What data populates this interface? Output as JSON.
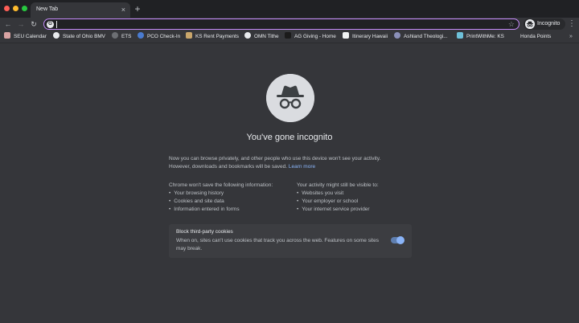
{
  "tab": {
    "title": "New Tab",
    "close_glyph": "×",
    "new_tab_glyph": "+"
  },
  "toolbar": {
    "back_glyph": "←",
    "forward_glyph": "→",
    "reload_glyph": "↻",
    "address_value": "",
    "search_engine_glyph": "G",
    "star_glyph": "☆",
    "profile_label": "Incognito",
    "menu_glyph": "⋮"
  },
  "bookmarks": [
    {
      "label": "SEU Calendar",
      "icon": "calendar-favicon",
      "color": "#d9a3a3"
    },
    {
      "label": "State of Ohio BMV",
      "icon": "globe-favicon",
      "color": "#e8eaed"
    },
    {
      "label": "ETS",
      "icon": "ets-favicon",
      "color": "#6c6f73"
    },
    {
      "label": "PCO Check-In",
      "icon": "pco-favicon",
      "color": "#4a7bd0"
    },
    {
      "label": "KS Rent Payments",
      "icon": "ks-favicon",
      "color": "#c9a66b"
    },
    {
      "label": "OMN Tithe",
      "icon": "globe-favicon",
      "color": "#e8eaed"
    },
    {
      "label": "AG Giving - Home",
      "icon": "ag-favicon",
      "color": "#1b1b1b"
    },
    {
      "label": "Itinerary Hawaii",
      "icon": "doc-favicon",
      "color": "#f1f3f4"
    },
    {
      "label": "Ashland Theologi...",
      "icon": "ashland-favicon",
      "color": "#8a8fb8"
    },
    {
      "label": "PrintWithMe: KS",
      "icon": "printwithme-favicon",
      "color": "#6ec1d9"
    },
    {
      "label": "Honda Points",
      "icon": "honda-favicon",
      "color": "#35363a"
    }
  ],
  "bookmarks_more_glyph": "»",
  "incognito_page": {
    "title": "You've gone incognito",
    "intro_line1": "Now you can browse privately, and other people who use this device won't see your activity.",
    "intro_line2": "However, downloads and bookmarks will be saved.",
    "learn_more": "Learn more",
    "left_heading": "Chrome won't save the following information:",
    "left_items": [
      "Your browsing history",
      "Cookies and site data",
      "Information entered in forms"
    ],
    "right_heading": "Your activity might still be visible to:",
    "right_items": [
      "Websites you visit",
      "Your employer or school",
      "Your internet service provider"
    ],
    "cookies_title": "Block third-party cookies",
    "cookies_desc": "When on, sites can't use cookies that track you across the web. Features on some sites may break.",
    "cookies_enabled": true
  }
}
